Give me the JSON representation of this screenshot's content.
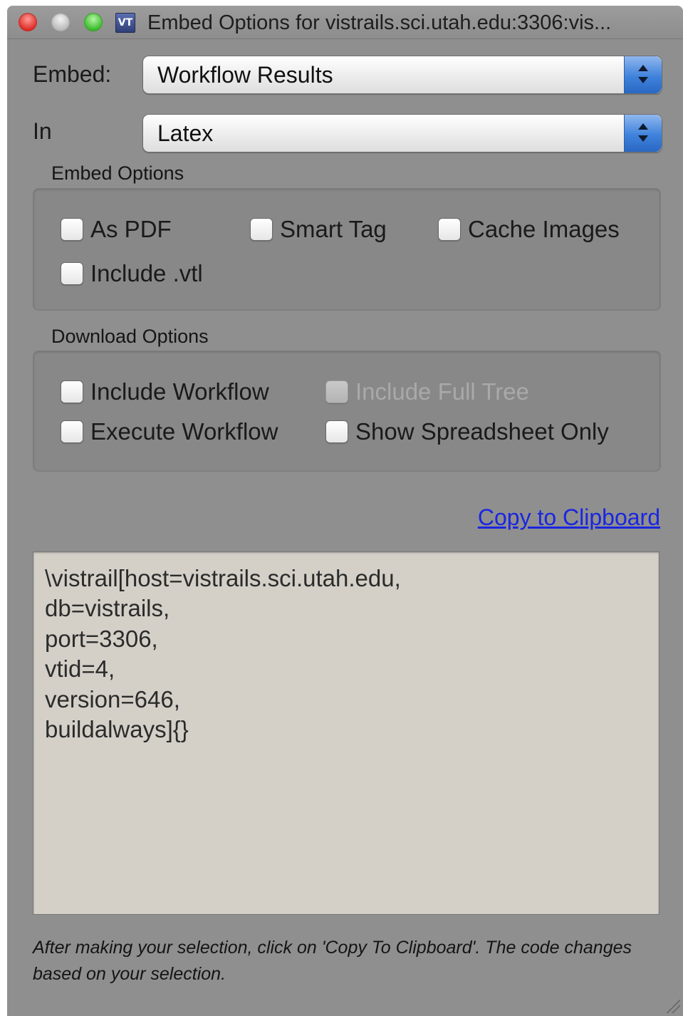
{
  "window": {
    "title": "Embed Options for vistrails.sci.utah.edu:3306:vis...",
    "app_icon_text": "VT"
  },
  "embed": {
    "label": "Embed:",
    "selected": "Workflow Results"
  },
  "in": {
    "label": "In",
    "selected": "Latex"
  },
  "embed_options": {
    "title": "Embed Options",
    "checkboxes": [
      {
        "label": "As PDF",
        "checked": false,
        "enabled": true
      },
      {
        "label": "Smart Tag",
        "checked": false,
        "enabled": true
      },
      {
        "label": "Cache Images",
        "checked": false,
        "enabled": true
      },
      {
        "label": "Include .vtl",
        "checked": false,
        "enabled": true
      }
    ]
  },
  "download_options": {
    "title": "Download Options",
    "checkboxes": [
      {
        "label": "Include Workflow",
        "checked": false,
        "enabled": true
      },
      {
        "label": "Include Full Tree",
        "checked": false,
        "enabled": false
      },
      {
        "label": "Execute Workflow",
        "checked": false,
        "enabled": true
      },
      {
        "label": "Show Spreadsheet Only",
        "checked": false,
        "enabled": true
      }
    ]
  },
  "copy_link": "Copy to Clipboard",
  "code": {
    "lines": [
      "\\vistrail[host=vistrails.sci.utah.edu,",
      "db=vistrails,",
      "port=3306,",
      "vtid=4,",
      "version=646,",
      "buildalways]{}"
    ]
  },
  "hint": "After making your selection, click on 'Copy To Clipboard'. The code changes based on your selection.",
  "colors": {
    "window_bg": "#8f8f8f",
    "code_bg": "#d4d0c8",
    "link": "#1a26e0",
    "stepper_blue": "#3f82dc"
  }
}
